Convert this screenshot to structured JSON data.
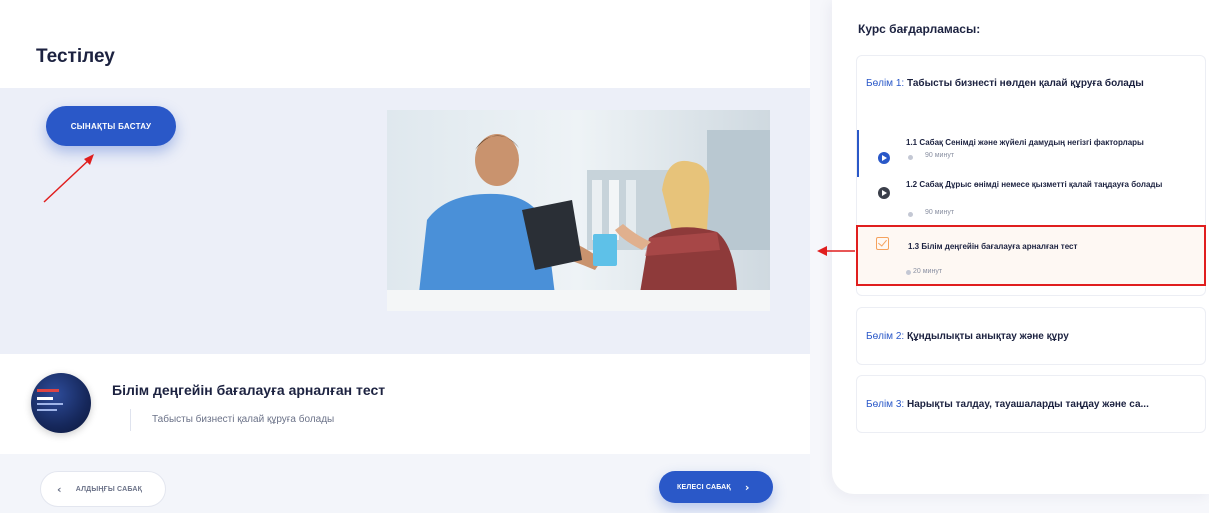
{
  "page": {
    "title": "Тестілеу",
    "start_button": "СЫНАҚТЫ БАСТАУ"
  },
  "lesson": {
    "title": "Білім деңгейін бағалауға арналған тест",
    "course": "Табысты бизнесті қалай құруға болады"
  },
  "navigation": {
    "prev_label": "АЛДЫҢҒЫ САБАҚ",
    "next_label": "КЕЛЕСІ САБАҚ"
  },
  "sidebar": {
    "title": "Курс бағдарламасы:",
    "sections": [
      {
        "part": "Бөлім 1:",
        "name": "Табысты бизнесті нөлден қалай құруға болады",
        "lessons": [
          {
            "title": "1.1 Сабақ Сенімді және жүйелі дамудың негізгі факторлары",
            "duration": "90 минут",
            "icon": "play-icon"
          },
          {
            "title": "1.2 Сабақ Дұрыс өнімді немесе қызметті қалай таңдауға болады",
            "duration": "90 минут",
            "icon": "play-icon"
          },
          {
            "title": "1.3 Білім деңгейін бағалауға арналған тест",
            "duration": "20 минут",
            "icon": "test-check-icon"
          }
        ]
      },
      {
        "part": "Бөлім 2:",
        "name": "Құндылықты анықтау және құру"
      },
      {
        "part": "Бөлім 3:",
        "name": "Нарықты талдау, тауашаларды таңдау және са..."
      }
    ]
  },
  "colors": {
    "accent": "#2a58c8",
    "highlight_border": "#e01e1e",
    "test_icon": "#f5a25d",
    "annotation_arrow": "#e01e1e"
  }
}
